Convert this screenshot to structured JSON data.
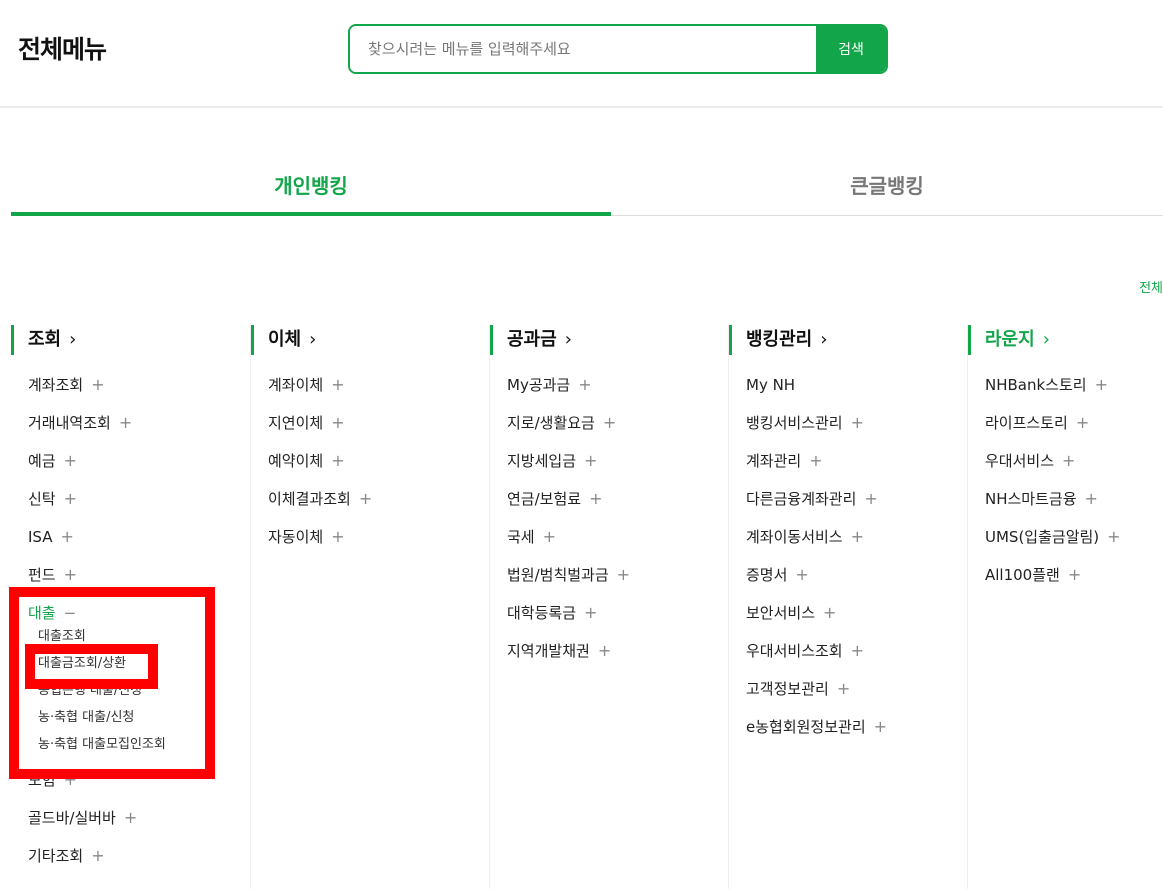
{
  "header": {
    "title": "전체메뉴",
    "search_placeholder": "찾으시려는 메뉴를 입력해주세요",
    "search_button": "검색"
  },
  "tabs": [
    {
      "label": "개인뱅킹",
      "active": true
    },
    {
      "label": "큰글뱅킹",
      "active": false
    }
  ],
  "all_link": "전체",
  "columns": [
    {
      "title": "조회",
      "items": [
        {
          "label": "계좌조회"
        },
        {
          "label": "거래내역조회"
        },
        {
          "label": "예금"
        },
        {
          "label": "신탁"
        },
        {
          "label": "ISA"
        },
        {
          "label": "펀드"
        },
        {
          "label": "대출",
          "expanded": true,
          "sub": [
            "대출조회",
            "대출금조회/상환",
            "농협은행 대출/신청",
            "농·축협 대출/신청",
            "농·축협 대출모집인조회"
          ]
        },
        {
          "label": "보험"
        },
        {
          "label": "골드바/실버바"
        },
        {
          "label": "기타조회"
        }
      ]
    },
    {
      "title": "이체",
      "items": [
        {
          "label": "계좌이체"
        },
        {
          "label": "지연이체"
        },
        {
          "label": "예약이체"
        },
        {
          "label": "이체결과조회"
        },
        {
          "label": "자동이체"
        }
      ]
    },
    {
      "title": "공과금",
      "items": [
        {
          "label": "My공과금"
        },
        {
          "label": "지로/생활요금"
        },
        {
          "label": "지방세입금"
        },
        {
          "label": "연금/보험료"
        },
        {
          "label": "국세"
        },
        {
          "label": "법원/범칙벌과금"
        },
        {
          "label": "대학등록금"
        },
        {
          "label": "지역개발채권"
        }
      ]
    },
    {
      "title": "뱅킹관리",
      "items": [
        {
          "label": "My NH"
        },
        {
          "label": "뱅킹서비스관리"
        },
        {
          "label": "계좌관리"
        },
        {
          "label": "다른금융계좌관리"
        },
        {
          "label": "계좌이동서비스"
        },
        {
          "label": "증명서"
        },
        {
          "label": "보안서비스"
        },
        {
          "label": "우대서비스조회"
        },
        {
          "label": "고객정보관리"
        },
        {
          "label": "e농협회원정보관리"
        }
      ]
    },
    {
      "title": "라운지",
      "items": [
        {
          "label": "NHBank스토리"
        },
        {
          "label": "라이프스토리"
        },
        {
          "label": "우대서비스"
        },
        {
          "label": "NH스마트금융"
        },
        {
          "label": "UMS(입출금알림)"
        },
        {
          "label": "All100플랜"
        }
      ]
    }
  ],
  "colors": {
    "accent": "#12a54a",
    "highlight": "#ff0000"
  }
}
